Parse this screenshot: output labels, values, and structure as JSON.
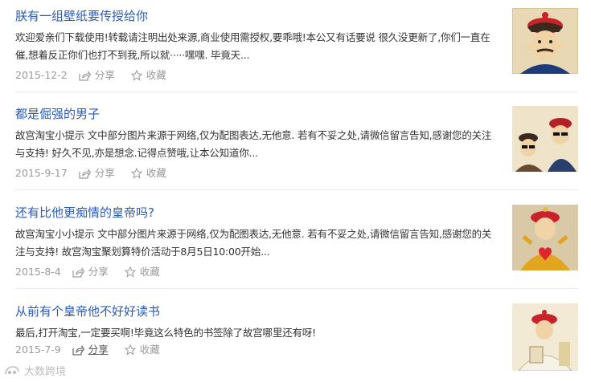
{
  "articles": [
    {
      "title": "朕有一组壁纸要传授给你",
      "summary": "欢迎爱亲们下载使用!转载请注明出处来源,商业使用需授权,要乖哦!本公又有话要说 很久没更新了,你们一直在催,想着反正你们也打不到我,所以就·····嘿嘿. 毕竟天...",
      "date": "2015-12-2",
      "share_label": "分享",
      "fav_label": "收藏",
      "thumb_icon": "emperor-portrait-thumbnail"
    },
    {
      "title": "都是倔强的男子",
      "summary": "故宫淘宝小提示 文中部分图片来源于网络,仅为配图表达,无他意. 若有不妥之处,请微信留言告知,感谢您的关注与支持! 好久不见,亦是想念.记得点赞哦,让本公知道你...",
      "date": "2015-9-17",
      "share_label": "分享",
      "fav_label": "收藏",
      "thumb_icon": "officials-sunglasses-thumbnail"
    },
    {
      "title": "还有比他更痴情的皇帝吗?",
      "summary": "故宫淘宝小小提示 文中部分图片来源于网络,仅为配图表达,无他意. 若有不妥之处,请微信留言告知,感谢您的关注与支持! 故宫淘宝聚划算特价活动于8月5日10:00开始...",
      "date": "2015-8-4",
      "share_label": "分享",
      "fav_label": "收藏",
      "thumb_icon": "emperor-heart-thumbnail"
    },
    {
      "title": "从前有个皇帝他不好好读书",
      "summary": "最后,打开淘宝,一定要买啊!毕竟这么特色的书签除了故宫哪里还有呀!",
      "date": "2015-7-9",
      "share_label": "分享",
      "fav_label": "收藏",
      "thumb_icon": "emperor-reading-thumbnail"
    }
  ],
  "watermark": {
    "text": "大数跨境",
    "icon": "watermark-logo-icon"
  },
  "colors": {
    "title": "#2a5bb8",
    "summary": "#333333",
    "meta": "#9a9a9a",
    "divider": "#ececec"
  }
}
